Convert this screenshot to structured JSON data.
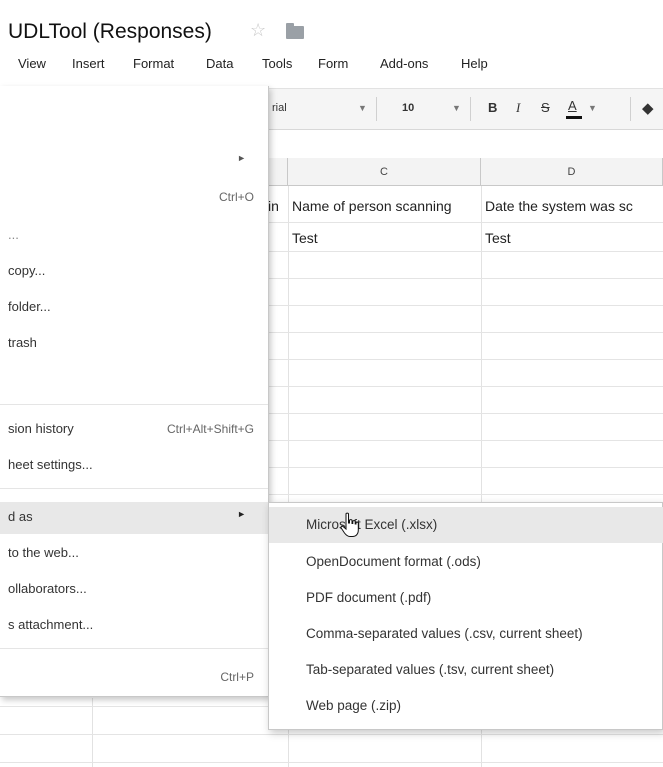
{
  "title": {
    "text": "UDLTool (Responses)"
  },
  "menubar": [
    "View",
    "Insert",
    "Format",
    "Data",
    "Tools",
    "Form",
    "Add-ons",
    "Help"
  ],
  "toolbar": {
    "font_name": "rial",
    "font_size": "10",
    "bold": "B",
    "italic": "I",
    "strikethrough": "S",
    "text_color": "A"
  },
  "grid": {
    "columns": [
      "C",
      "D"
    ],
    "header_row": [
      "in",
      "Name of person scanning",
      "Date the system was sc"
    ],
    "rows": [
      [
        "",
        "Test",
        "Test"
      ]
    ]
  },
  "file_menu": {
    "items": [
      {
        "label": "",
        "shortcut": "",
        "has_submenu": true
      },
      {
        "label": "",
        "shortcut": "Ctrl+O"
      },
      {
        "label": "...",
        "shortcut": ""
      },
      {
        "label": "copy...",
        "shortcut": ""
      },
      {
        "label": "folder...",
        "shortcut": ""
      },
      {
        "label": "trash",
        "shortcut": ""
      },
      {
        "label": "sion history",
        "shortcut": "Ctrl+Alt+Shift+G"
      },
      {
        "label": "heet settings...",
        "shortcut": ""
      },
      {
        "label": "d as",
        "shortcut": "",
        "has_submenu": true,
        "highlighted": true
      },
      {
        "label": "to the web...",
        "shortcut": ""
      },
      {
        "label": "ollaborators...",
        "shortcut": ""
      },
      {
        "label": "s attachment...",
        "shortcut": ""
      },
      {
        "label": "",
        "shortcut": "Ctrl+P"
      }
    ]
  },
  "download_submenu": {
    "items": [
      {
        "label": "Microsoft Excel (.xlsx)",
        "highlighted": true
      },
      {
        "label": "OpenDocument format (.ods)"
      },
      {
        "label": "PDF document (.pdf)"
      },
      {
        "label": "Comma-separated values (.csv, current sheet)"
      },
      {
        "label": "Tab-separated values (.tsv, current sheet)"
      },
      {
        "label": "Web page (.zip)"
      }
    ]
  },
  "colors": {
    "menu_highlight": "#e8e8e8",
    "toolbar_bg": "#f5f5f5",
    "header_bg": "#f3f3f3"
  }
}
